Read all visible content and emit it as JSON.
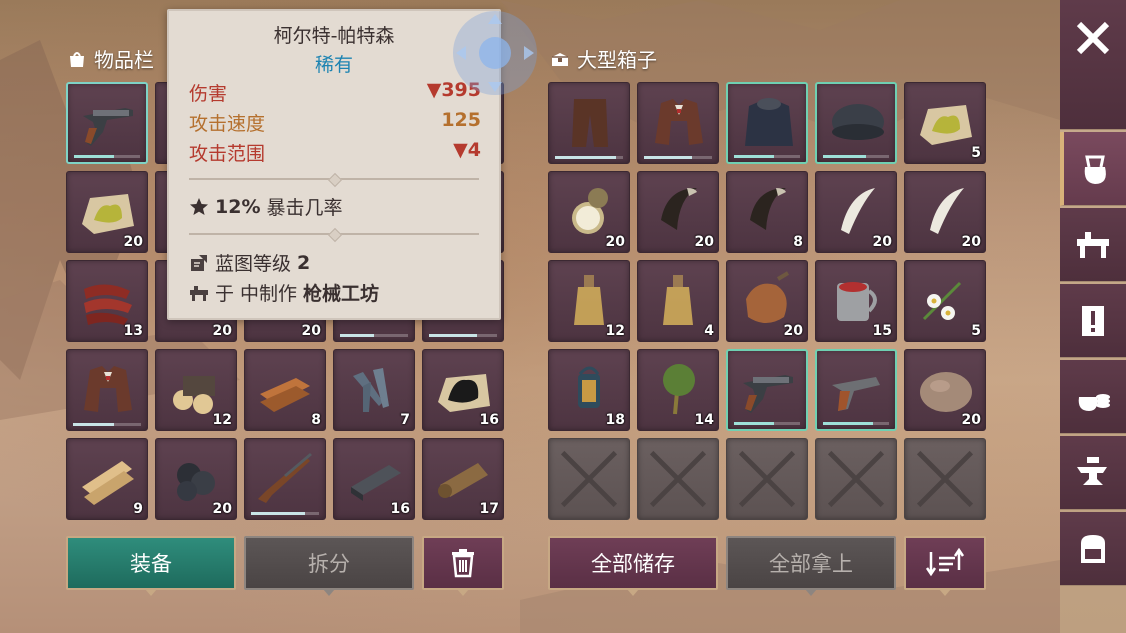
{
  "left_title": "物品栏",
  "right_title": "大型箱子",
  "tooltip": {
    "name": "柯尔特-帕特森",
    "rarity": "稀有",
    "stats": [
      {
        "label": "伤害",
        "value": "▼395"
      },
      {
        "label": "攻击速度",
        "value": "125"
      },
      {
        "label": "攻击范围",
        "value": "▼4"
      }
    ],
    "crit": "12%",
    "crit_label": "暴击几率",
    "blueprint_label": "蓝图等级",
    "blueprint_level": "2",
    "craft_prefix": "于 中制作",
    "craft_station": "枪械工坊"
  },
  "inventory": [
    {
      "name": "revolver-icon",
      "qty": "",
      "dur": 0.6,
      "state": "selected"
    },
    {
      "name": "hidden",
      "qty": "",
      "dur": null,
      "state": "hidden"
    },
    {
      "name": "hidden",
      "qty": "",
      "dur": null,
      "state": "hidden"
    },
    {
      "name": "hidden",
      "qty": "",
      "dur": null,
      "state": "hidden"
    },
    {
      "name": "hidden",
      "qty": "",
      "dur": null,
      "state": "hidden"
    },
    {
      "name": "sulfur-icon",
      "qty": "20",
      "dur": null,
      "state": ""
    },
    {
      "name": "hidden",
      "qty": "",
      "dur": null,
      "state": "hidden"
    },
    {
      "name": "hidden",
      "qty": "",
      "dur": null,
      "state": "hidden"
    },
    {
      "name": "hidden",
      "qty": "",
      "dur": null,
      "state": "hidden"
    },
    {
      "name": "hidden",
      "qty": "",
      "dur": null,
      "state": "hidden"
    },
    {
      "name": "meat-jerky-icon",
      "qty": "13",
      "dur": null,
      "state": ""
    },
    {
      "name": "hidden",
      "qty": "20",
      "dur": null,
      "state": "partial"
    },
    {
      "name": "hidden",
      "qty": "20",
      "dur": null,
      "state": "partial"
    },
    {
      "name": "hidden",
      "qty": "",
      "dur": 0.5,
      "state": "partial"
    },
    {
      "name": "hidden",
      "qty": "",
      "dur": 0.7,
      "state": "partial"
    },
    {
      "name": "jacket-icon",
      "qty": "",
      "dur": 0.6,
      "state": ""
    },
    {
      "name": "logs-icon",
      "qty": "12",
      "dur": null,
      "state": ""
    },
    {
      "name": "planks-icon",
      "qty": "8",
      "dur": null,
      "state": ""
    },
    {
      "name": "nails-icon",
      "qty": "7",
      "dur": null,
      "state": ""
    },
    {
      "name": "coal-dust-icon",
      "qty": "16",
      "dur": null,
      "state": ""
    },
    {
      "name": "boards-icon",
      "qty": "9",
      "dur": null,
      "state": ""
    },
    {
      "name": "coal-icon",
      "qty": "20",
      "dur": null,
      "state": ""
    },
    {
      "name": "rifle-icon",
      "qty": "",
      "dur": 0.8,
      "state": ""
    },
    {
      "name": "iron-ingot-icon",
      "qty": "16",
      "dur": null,
      "state": ""
    },
    {
      "name": "leather-roll-icon",
      "qty": "17",
      "dur": null,
      "state": ""
    }
  ],
  "chest": [
    {
      "name": "pants-icon",
      "qty": "",
      "dur": 0.9,
      "state": ""
    },
    {
      "name": "jacket-icon",
      "qty": "",
      "dur": 0.7,
      "state": ""
    },
    {
      "name": "fur-coat-icon",
      "qty": "",
      "dur": 0.6,
      "state": "rare"
    },
    {
      "name": "fur-hat-icon",
      "qty": "",
      "dur": 0.65,
      "state": "rare"
    },
    {
      "name": "sulfur-icon",
      "qty": "5",
      "dur": null,
      "state": ""
    },
    {
      "name": "pocket-watch-icon",
      "qty": "20",
      "dur": null,
      "state": ""
    },
    {
      "name": "fang-icon",
      "qty": "20",
      "dur": null,
      "state": ""
    },
    {
      "name": "fang-icon",
      "qty": "8",
      "dur": null,
      "state": ""
    },
    {
      "name": "tooth-icon",
      "qty": "20",
      "dur": null,
      "state": ""
    },
    {
      "name": "tooth-icon",
      "qty": "20",
      "dur": null,
      "state": ""
    },
    {
      "name": "bottle-icon",
      "qty": "12",
      "dur": null,
      "state": ""
    },
    {
      "name": "bottle-icon",
      "qty": "4",
      "dur": null,
      "state": ""
    },
    {
      "name": "flask-icon",
      "qty": "20",
      "dur": null,
      "state": ""
    },
    {
      "name": "mug-icon",
      "qty": "15",
      "dur": null,
      "state": ""
    },
    {
      "name": "flowers-icon",
      "qty": "5",
      "dur": null,
      "state": ""
    },
    {
      "name": "lantern-icon",
      "qty": "18",
      "dur": null,
      "state": ""
    },
    {
      "name": "herb-bundle-icon",
      "qty": "14",
      "dur": null,
      "state": ""
    },
    {
      "name": "revolver-icon",
      "qty": "",
      "dur": 0.6,
      "state": "rare"
    },
    {
      "name": "pistol-icon",
      "qty": "",
      "dur": 0.75,
      "state": "rare"
    },
    {
      "name": "stone-icon",
      "qty": "20",
      "dur": null,
      "state": ""
    },
    {
      "name": "empty",
      "qty": "",
      "dur": null,
      "state": "empty"
    },
    {
      "name": "empty",
      "qty": "",
      "dur": null,
      "state": "empty"
    },
    {
      "name": "empty",
      "qty": "",
      "dur": null,
      "state": "empty"
    },
    {
      "name": "empty",
      "qty": "",
      "dur": null,
      "state": "empty"
    },
    {
      "name": "empty",
      "qty": "",
      "dur": null,
      "state": "empty"
    }
  ],
  "buttons": {
    "equip": "装备",
    "split": "拆分",
    "store_all": "全部储存",
    "take_all": "全部拿上"
  },
  "sidebar_icons": [
    "close-icon",
    "sack-icon",
    "workbench-icon",
    "quest-icon",
    "resources-icon",
    "anvil-icon",
    "backpack-icon"
  ]
}
